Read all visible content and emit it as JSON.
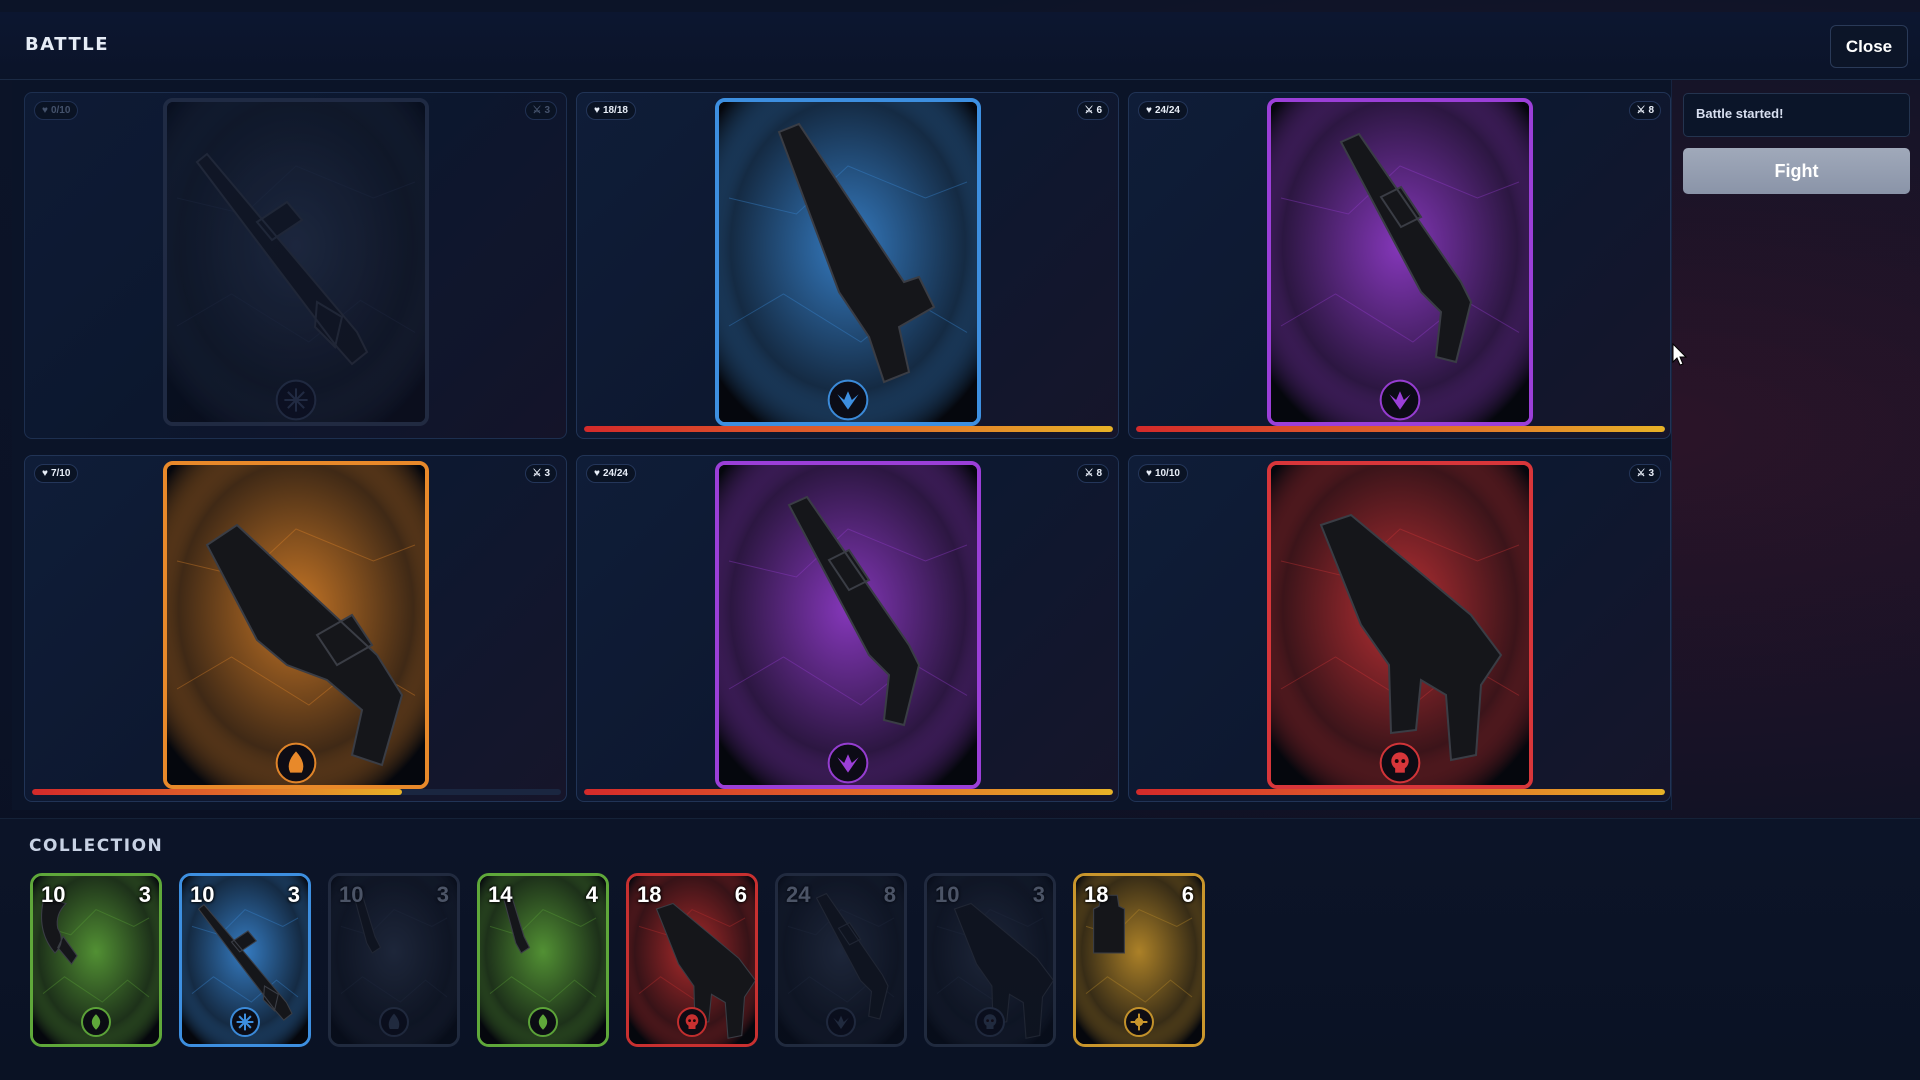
{
  "header": {
    "title": "BATTLE",
    "close_label": "Close"
  },
  "sidebar": {
    "log_text": "Battle started!",
    "fight_label": "Fight"
  },
  "board": {
    "slots": [
      {
        "hp": "0/10",
        "attack": "3",
        "weapon": "sniper-rifle",
        "rarity": "common",
        "emblem": "snowflake-icon",
        "hp_fraction": 0,
        "empty": true
      },
      {
        "hp": "18/18",
        "attack": "6",
        "weapon": "silenced-pistol",
        "rarity": "rare",
        "emblem": "wing-emblem-icon",
        "hp_fraction": 1,
        "empty": false
      },
      {
        "hp": "24/24",
        "attack": "8",
        "weapon": "shotgun",
        "rarity": "epic",
        "emblem": "wing-emblem-icon",
        "hp_fraction": 1,
        "empty": false
      },
      {
        "hp": "7/10",
        "attack": "3",
        "weapon": "combat-shotgun",
        "rarity": "legendary",
        "emblem": "flame-icon",
        "hp_fraction": 0.7,
        "empty": false
      },
      {
        "hp": "24/24",
        "attack": "8",
        "weapon": "shotgun",
        "rarity": "epic",
        "emblem": "wing-emblem-icon",
        "hp_fraction": 1,
        "empty": false
      },
      {
        "hp": "10/10",
        "attack": "3",
        "weapon": "smg",
        "rarity": "mythic",
        "emblem": "skull-icon",
        "hp_fraction": 1,
        "empty": false
      }
    ]
  },
  "collection": {
    "title": "COLLECTION",
    "cards": [
      {
        "hp": "10",
        "attack": "3",
        "weapon": "karambit",
        "theme": "green",
        "emblem": "leaf-icon",
        "dim": false
      },
      {
        "hp": "10",
        "attack": "3",
        "weapon": "sniper-rifle",
        "theme": "blue",
        "emblem": "snowflake-icon",
        "dim": false
      },
      {
        "hp": "10",
        "attack": "3",
        "weapon": "combat-knife",
        "theme": "gray",
        "emblem": "flame-icon",
        "dim": true
      },
      {
        "hp": "14",
        "attack": "4",
        "weapon": "combat-knife",
        "theme": "green",
        "emblem": "leaf-icon",
        "dim": false
      },
      {
        "hp": "18",
        "attack": "6",
        "weapon": "smg",
        "theme": "red",
        "emblem": "skull-icon",
        "dim": false
      },
      {
        "hp": "24",
        "attack": "8",
        "weapon": "shotgun",
        "theme": "gray",
        "emblem": "wing-emblem-icon",
        "dim": true
      },
      {
        "hp": "10",
        "attack": "3",
        "weapon": "smg",
        "theme": "gray",
        "emblem": "skull-icon",
        "dim": true
      },
      {
        "hp": "18",
        "attack": "6",
        "weapon": "grenade",
        "theme": "gold",
        "emblem": "sun-icon",
        "dim": false
      }
    ]
  },
  "colors": {
    "common": "#3a4660",
    "rare": "#3d8fe0",
    "epic": "#9b3fd8",
    "legendary": "#e8892a",
    "mythic": "#d8363a",
    "green": "#5fa83a",
    "blue": "#3d8fe0",
    "gray": "#3c475e",
    "red": "#c83030",
    "gold": "#c9962c",
    "hp_bar_start": "#d42a2a",
    "hp_bar_end": "#e8b227"
  }
}
